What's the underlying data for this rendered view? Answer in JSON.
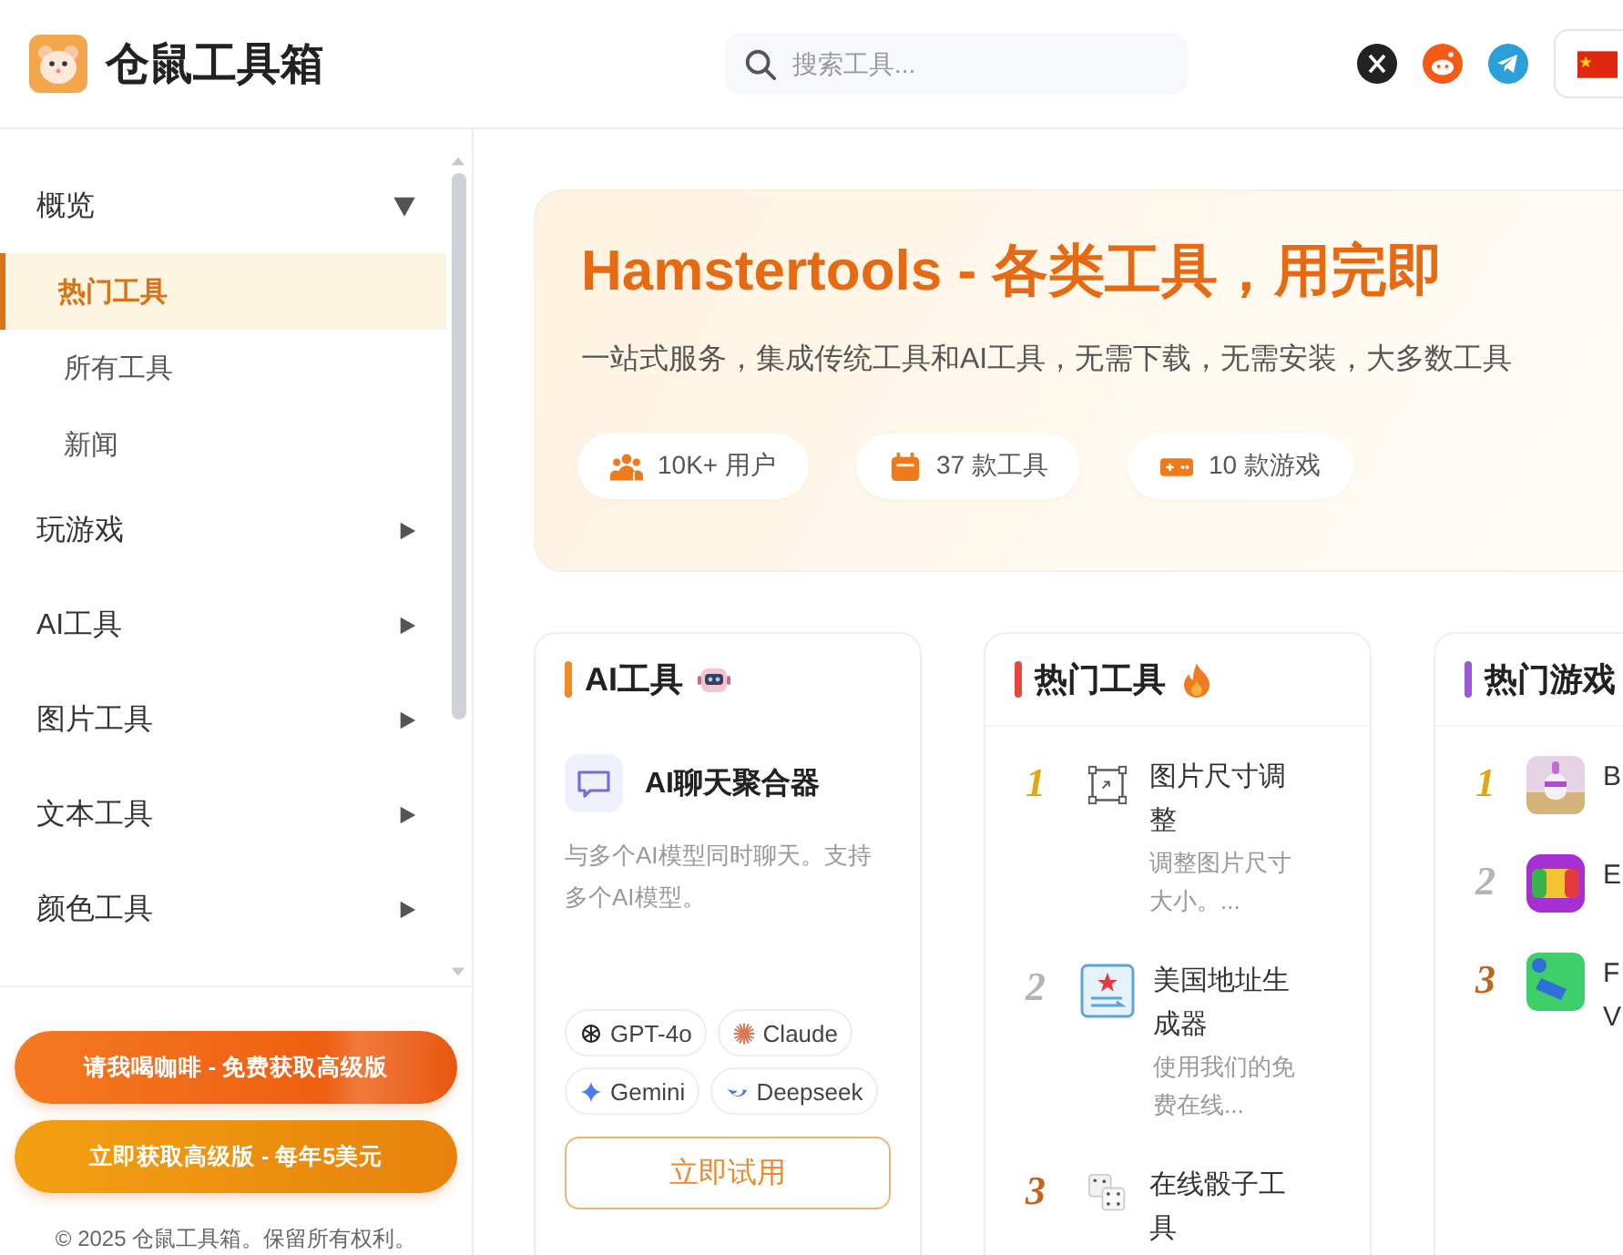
{
  "header": {
    "logo_text": "仓鼠工具箱",
    "search": {
      "placeholder": "搜索工具..."
    }
  },
  "sidebar": {
    "groups": [
      {
        "label": "概览",
        "expanded": true,
        "children": [
          {
            "label": "热门工具",
            "selected": true
          },
          {
            "label": "所有工具",
            "selected": false
          },
          {
            "label": "新闻",
            "selected": false
          }
        ]
      },
      {
        "label": "玩游戏",
        "expanded": false
      },
      {
        "label": "AI工具",
        "expanded": false
      },
      {
        "label": "图片工具",
        "expanded": false
      },
      {
        "label": "文本工具",
        "expanded": false
      },
      {
        "label": "颜色工具",
        "expanded": false
      }
    ],
    "buttons": [
      {
        "kind": "coffee",
        "label": "请我喝咖啡 - 免费获取高级版"
      },
      {
        "kind": "premium",
        "label": "立即获取高级版 - 每年5美元"
      }
    ],
    "footer": "© 2025 仓鼠工具箱。保留所有权利。"
  },
  "hero": {
    "title": "Hamstertools - 各类工具，用完即",
    "subtitle": "一站式服务，集成传统工具和AI工具，无需下载，无需安装，大多数工具",
    "stats": [
      {
        "kind": "users",
        "text": "10K+ 用户"
      },
      {
        "kind": "tools",
        "text": "37 款工具"
      },
      {
        "kind": "games",
        "text": "10 款游戏"
      }
    ]
  },
  "cards": [
    {
      "kind": "ai",
      "title": "AI工具",
      "color": "#f08a24",
      "tool": {
        "name": "AI聊天聚合器",
        "desc": "与多个AI模型同时聊天。支持多个AI模型。"
      },
      "models": [
        {
          "kind": "openai",
          "name": "GPT-4o"
        },
        {
          "kind": "claude",
          "name": "Claude"
        },
        {
          "kind": "gemini",
          "name": "Gemini"
        },
        {
          "kind": "deepseek",
          "name": "Deepseek"
        }
      ],
      "button": "立即试用"
    },
    {
      "kind": "tools",
      "title": "热门工具",
      "color": "#e5483a",
      "items": [
        {
          "rank": "1",
          "color": "#e0a614",
          "kind": "resize",
          "title": "图片尺寸调整",
          "desc": "调整图片尺寸大小。..."
        },
        {
          "rank": "2",
          "color": "#b4b4b4",
          "kind": "address",
          "title": "美国地址生成器",
          "desc": "使用我们的免费在线..."
        },
        {
          "rank": "3",
          "color": "#c2651c",
          "kind": "dice",
          "title": "在线骰子工具"
        }
      ]
    },
    {
      "kind": "games",
      "title": "热门游戏",
      "color": "#9b59d6",
      "items": [
        {
          "rank": "1",
          "color": "#e0a614",
          "kind": "cake",
          "title_lines": [
            "B"
          ]
        },
        {
          "rank": "2",
          "color": "#b4b4b4",
          "kind": "candy",
          "title_lines": [
            "E"
          ]
        },
        {
          "rank": "3",
          "color": "#c2651c",
          "kind": "car",
          "title_lines": [
            "F",
            "V"
          ]
        }
      ]
    }
  ]
}
